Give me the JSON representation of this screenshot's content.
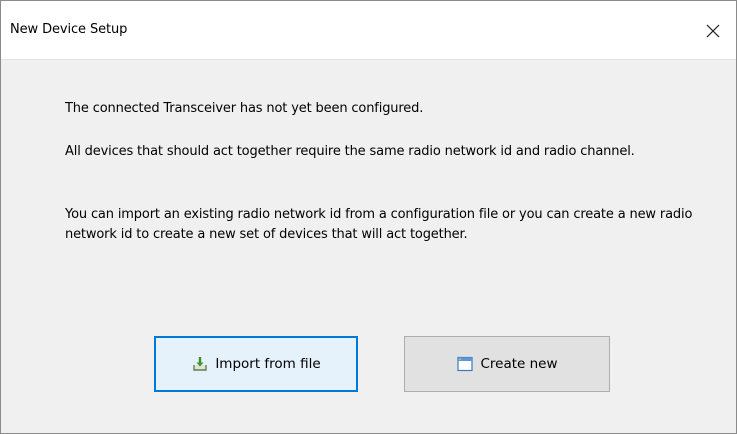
{
  "window": {
    "title": "New Device Setup"
  },
  "message": {
    "line1": "The connected Transceiver has not yet been configured.",
    "line2": "All devices that should act together require the same radio network id and radio channel.",
    "line3": "You can import an existing radio network id from a configuration file or you can create a new radio network id to create a new set of devices that will act together."
  },
  "buttons": {
    "import_label": "Import from file",
    "import_icon": "import-file-icon",
    "create_label": "Create new",
    "create_icon": "new-window-icon"
  },
  "colors": {
    "focus_border": "#0078d7",
    "button_bg": "#e1e1e1",
    "dialog_bg": "#f0f0f0"
  }
}
